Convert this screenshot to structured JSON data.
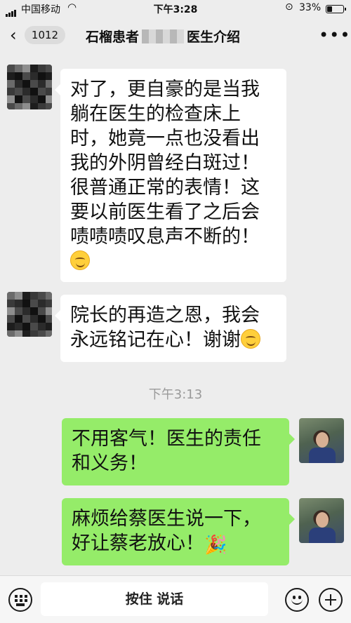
{
  "status": {
    "carrier": "中国移动",
    "time": "下午3:28",
    "battery": "33%",
    "battery_level": 0.33,
    "icons": [
      "signal-icon",
      "wifi-icon",
      "orientation-lock-icon",
      "battery-icon"
    ]
  },
  "nav": {
    "unread_count": "1012",
    "title_prefix": "石榴患者",
    "title_suffix": "医生介绍",
    "icons": [
      "back-chevron-icon",
      "more-icon"
    ]
  },
  "messages": [
    {
      "side": "in",
      "lines": [
        "对了，更自豪的是当我",
        "躺在医生的检查床上",
        "时，她竟一点也没看出",
        "我的外阴曾经白斑过！",
        "很普通正常的表情！这",
        "要以前医生看了之后会",
        "啧啧啧叹息声不断的！"
      ],
      "emoji": "smiling-face-icon"
    },
    {
      "side": "in",
      "lines": [
        "院长的再造之恩，我会",
        "永远铭记在心！谢谢"
      ],
      "emoji": "smiling-face-icon"
    },
    {
      "side": "out",
      "lines": [
        "不用客气！医生的责任",
        "和义务！"
      ]
    },
    {
      "side": "out",
      "lines": [
        "麻烦给蔡医生说一下，",
        "好让蔡老放心！"
      ],
      "emoji": "party-popper-icon"
    }
  ],
  "time_separator": "下午3:13",
  "input_bar": {
    "voice_label": "按住 说话",
    "icons": [
      "keyboard-icon",
      "emoji-icon",
      "plus-icon"
    ]
  },
  "colors": {
    "background": "#ededed",
    "incoming_bubble": "#ffffff",
    "outgoing_bubble": "#95ec69"
  }
}
